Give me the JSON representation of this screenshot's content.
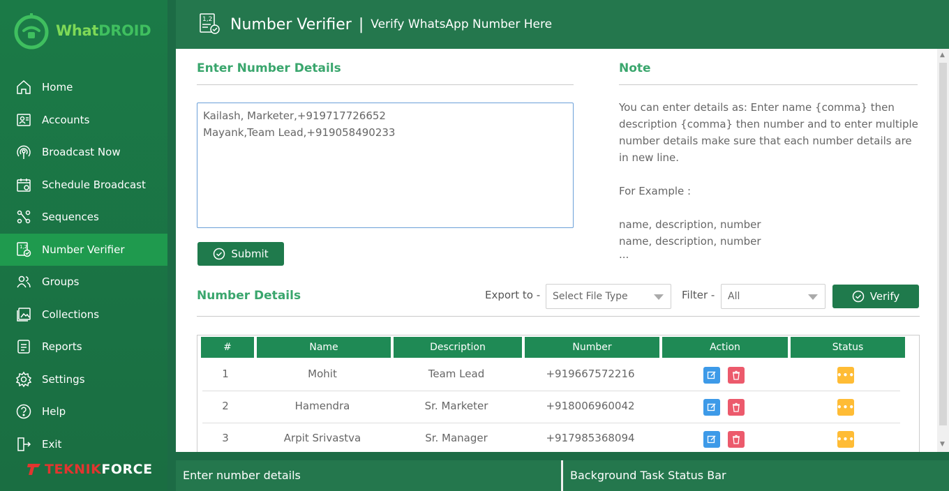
{
  "app": {
    "logo_prefix": "What",
    "logo_suffix": "DROID",
    "brand_a": "TEKNIK",
    "brand_b": "FORCE"
  },
  "sidebar": {
    "items": [
      {
        "label": "Home",
        "icon": "home-icon"
      },
      {
        "label": "Accounts",
        "icon": "accounts-icon"
      },
      {
        "label": "Broadcast Now",
        "icon": "broadcast-icon"
      },
      {
        "label": "Schedule Broadcast",
        "icon": "calendar-icon"
      },
      {
        "label": "Sequences",
        "icon": "sequences-icon"
      },
      {
        "label": "Number Verifier",
        "icon": "verifier-icon",
        "active": true
      },
      {
        "label": "Groups",
        "icon": "groups-icon"
      },
      {
        "label": "Collections",
        "icon": "collections-icon"
      },
      {
        "label": "Reports",
        "icon": "reports-icon"
      },
      {
        "label": "Settings",
        "icon": "gear-icon"
      },
      {
        "label": "Help",
        "icon": "help-icon"
      },
      {
        "label": "Exit",
        "icon": "exit-icon"
      }
    ]
  },
  "header": {
    "title": "Number Verifier",
    "separator": "|",
    "subtitle": "Verify WhatsApp Number Here"
  },
  "entry": {
    "title": "Enter Number Details",
    "textarea_value": "Kailash, Marketer,+919717726652\nMayank,Team Lead,+919058490233",
    "submit_label": "Submit"
  },
  "note": {
    "title": "Note",
    "body": "You can enter details as: Enter name {comma} then description {comma} then number and to enter multiple number details make sure that each number details are in new line.",
    "example_label": "For Example :",
    "example_lines": [
      "name, description, number",
      "name, description, number",
      "..."
    ]
  },
  "details": {
    "title": "Number Details",
    "export_label": "Export to -",
    "export_placeholder": "Select File Type",
    "filter_label": "Filter -",
    "filter_value": "All",
    "verify_label": "Verify"
  },
  "table": {
    "columns": [
      "#",
      "Name",
      "Description",
      "Number",
      "Action",
      "Status"
    ],
    "rows": [
      {
        "idx": "1",
        "name": "Mohit",
        "description": "Team Lead",
        "number": "+919667572216"
      },
      {
        "idx": "2",
        "name": "Hamendra",
        "description": "Sr. Marketer",
        "number": "+918006960042"
      },
      {
        "idx": "3",
        "name": "Arpit Srivastva",
        "description": "Sr. Manager",
        "number": "+917985368094"
      }
    ],
    "status_glyph": "•••"
  },
  "statusbar": {
    "left": "Enter number details",
    "right": "Background Task Status Bar"
  },
  "colors": {
    "sidebar": "#1b7a47",
    "active": "#1f9a4e",
    "header": "#24774d",
    "accent": "#3aa66d",
    "edit": "#3d9ae8",
    "delete": "#ec5a6c",
    "status": "#ffbc35"
  }
}
